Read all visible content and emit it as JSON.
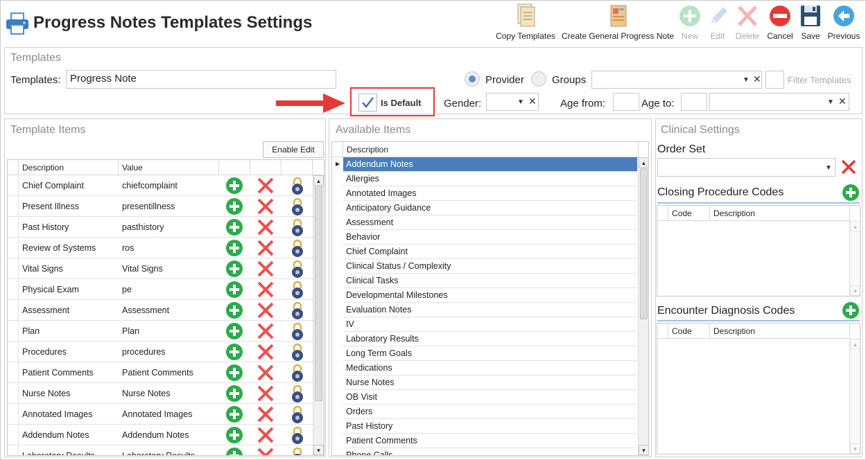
{
  "header": {
    "title": "Progress Notes Templates Settings",
    "toolbar": [
      {
        "key": "copy",
        "label": "Copy Templates",
        "icon": "copy-templates-icon",
        "enabled": true
      },
      {
        "key": "create",
        "label": "Create General Progress Note",
        "icon": "general-note-icon",
        "enabled": true
      },
      {
        "key": "new",
        "label": "New",
        "icon": "plus-circle-icon",
        "enabled": false
      },
      {
        "key": "edit",
        "label": "Edit",
        "icon": "pencil-icon",
        "enabled": false
      },
      {
        "key": "delete",
        "label": "Delete",
        "icon": "delete-x-icon",
        "enabled": false
      },
      {
        "key": "cancel",
        "label": "Cancel",
        "icon": "cancel-icon",
        "enabled": true
      },
      {
        "key": "save",
        "label": "Save",
        "icon": "floppy-disk-icon",
        "enabled": true
      },
      {
        "key": "previous",
        "label": "Previous",
        "icon": "back-arrow-icon",
        "enabled": true
      }
    ]
  },
  "templates": {
    "section_title": "Templates",
    "label": "Templates:",
    "value": "Progress Note",
    "provider_label": "Provider",
    "groups_label": "Groups",
    "provider_selected": true,
    "filter_label": "Filter Templates",
    "is_default_label": "Is Default",
    "is_default_checked": true,
    "gender_label": "Gender:",
    "age_from_label": "Age from:",
    "age_to_label": "Age to:"
  },
  "template_items": {
    "section_title": "Template Items",
    "enable_edit_label": "Enable Edit",
    "columns": [
      "Description",
      "Value"
    ],
    "rows": [
      {
        "description": "Chief Complaint",
        "value": "chiefcomplaint"
      },
      {
        "description": "Present Illness",
        "value": "presentillness"
      },
      {
        "description": "Past History",
        "value": "pasthistory"
      },
      {
        "description": "Review of Systems",
        "value": "ros"
      },
      {
        "description": "Vital Signs",
        "value": "Vital Signs"
      },
      {
        "description": "Physical Exam",
        "value": "pe"
      },
      {
        "description": "Assessment",
        "value": "Assessment"
      },
      {
        "description": "Plan",
        "value": "Plan"
      },
      {
        "description": "Procedures",
        "value": "procedures"
      },
      {
        "description": "Patient Comments",
        "value": "Patient Comments"
      },
      {
        "description": "Nurse Notes",
        "value": "Nurse Notes"
      },
      {
        "description": "Annotated Images",
        "value": "Annotated Images"
      },
      {
        "description": "Addendum Notes",
        "value": "Addendum Notes"
      },
      {
        "description": "Laboratory Results",
        "value": "Laboratory Results"
      }
    ]
  },
  "available_items": {
    "section_title": "Available Items",
    "column": "Description",
    "selected_index": 0,
    "rows": [
      "Addendum Notes",
      "Allergies",
      "Annotated Images",
      "Anticipatory Guidance",
      "Assessment",
      "Behavior",
      "Chief Complaint",
      "Clinical Status / Complexity",
      "Clinical Tasks",
      "Developmental Milestones",
      "Evaluation Notes",
      "IV",
      "Laboratory Results",
      "Long Term Goals",
      "Medications",
      "Nurse Notes",
      "OB Visit",
      "Orders",
      "Past History",
      "Patient Comments",
      "Phone Calls"
    ]
  },
  "clinical_settings": {
    "section_title": "Clinical Settings",
    "order_set_label": "Order Set",
    "closing_label": "Closing Procedure Codes",
    "encounter_label": "Encounter Diagnosis Codes",
    "code_col": "Code",
    "desc_col": "Description"
  },
  "colors": {
    "accent_blue": "#4a7ebb",
    "add_green": "#2eaa4c",
    "delete_red": "#ef4f4f",
    "highlight_red": "#e53935"
  }
}
